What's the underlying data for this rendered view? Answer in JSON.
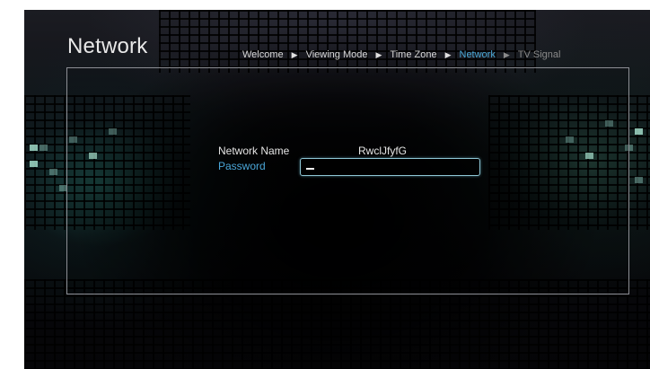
{
  "header": {
    "title": "Network"
  },
  "breadcrumb": {
    "steps": [
      {
        "label": "Welcome",
        "state": "done"
      },
      {
        "label": "Viewing Mode",
        "state": "done"
      },
      {
        "label": "Time Zone",
        "state": "done"
      },
      {
        "label": "Network",
        "state": "current"
      },
      {
        "label": "TV Signal",
        "state": "upcoming"
      }
    ],
    "separator_icon": "triangle-right-icon"
  },
  "form": {
    "network_name_label": "Network Name",
    "network_name_value": "RwclJfyfG",
    "password_label": "Password",
    "password_value": ""
  },
  "colors": {
    "accent": "#49a7d6",
    "text": "#e4e4e4",
    "panel_border": "#8d8f95",
    "field_border": "#8fc7d6"
  }
}
